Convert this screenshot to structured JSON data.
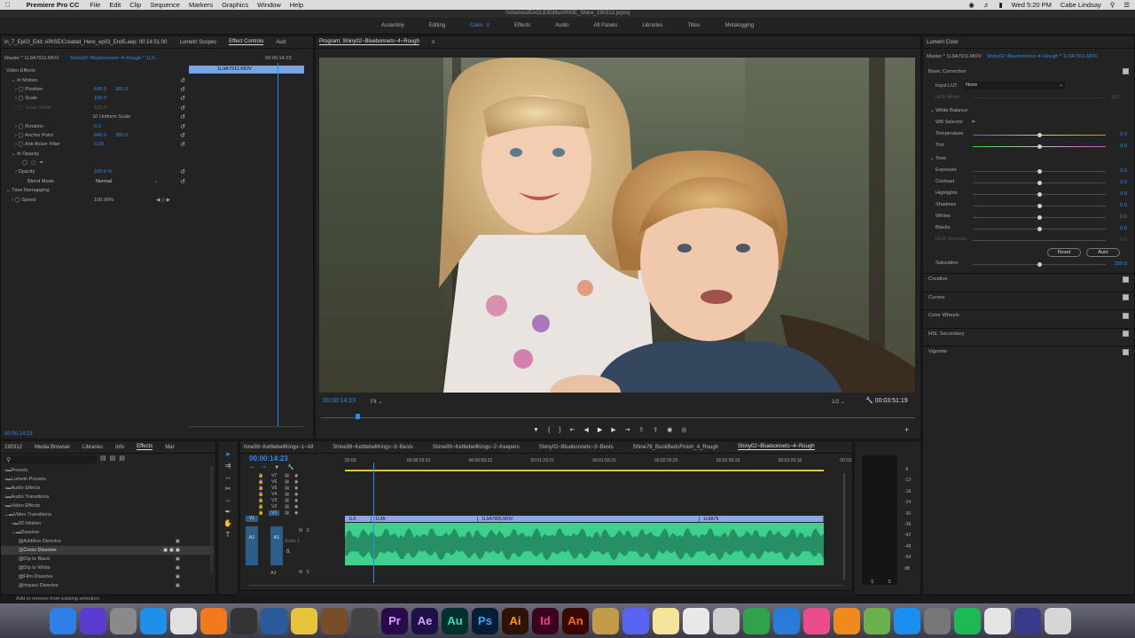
{
  "menubar": {
    "app": "Premiere Pro CC",
    "items": [
      "File",
      "Edit",
      "Clip",
      "Sequence",
      "Markers",
      "Graphics",
      "Window",
      "Help"
    ],
    "clock": "Wed 5:20 PM",
    "user": "Cabe Lindsay"
  },
  "window_title": "/Volumes/EAGLE/Edits/ARISE_Shine_190312.prproj",
  "workspaces": [
    {
      "label": "Assembly"
    },
    {
      "label": "Editing"
    },
    {
      "label": "Color",
      "active": true
    },
    {
      "label": "Effects"
    },
    {
      "label": "Audio"
    },
    {
      "label": "All Panels"
    },
    {
      "label": "Libraries"
    },
    {
      "label": "Titles"
    },
    {
      "label": "Metalogging"
    }
  ],
  "effect_controls": {
    "tabs": [
      "in_7_Ep03_Edit: ARISE/Created_Here_ep03_End5.aep: 00:14:51:00",
      "Lumetri Scopes",
      "Effect Controls",
      "Aud"
    ],
    "master": "Master * 1L9A7911.MOV",
    "sequence": "Shiny02~Bluebonnets~4~Rough * 1L9...",
    "mini_time": "00:00:14:23",
    "clip": "1L9A7911.MOV",
    "video_effects": "Video Effects",
    "motion": "Motion",
    "props": [
      {
        "name": "Position",
        "v1": "640.0",
        "v2": "360.0"
      },
      {
        "name": "Scale",
        "v1": "100.0"
      },
      {
        "name": "Scale Width",
        "v1": "100.0",
        "disabled": true
      },
      {
        "name": "Uniform Scale",
        "checkbox": true
      },
      {
        "name": "Rotation",
        "v1": "0.0"
      },
      {
        "name": "Anchor Point",
        "v1": "640.0",
        "v2": "360.0"
      },
      {
        "name": "Anti-flicker Filter",
        "v1": "0.00"
      }
    ],
    "opacity": "Opacity",
    "opacity_value": "100.0 %",
    "blend_mode_label": "Blend Mode",
    "blend_mode": "Normal",
    "time_remapping": "Time Remapping",
    "speed_label": "Speed",
    "speed_value": "100.00%",
    "timecode": "00:00:14:23"
  },
  "program": {
    "tab": "Program: Shiny02~Bluebonnets~4~Rough",
    "timecode": "00:00:14:23",
    "fit": "Fit",
    "resolution": "1/2",
    "duration": "00:03:51:19"
  },
  "lumetri": {
    "title": "Lumetri Color",
    "master": "Master * 1L9A7911.MOV",
    "sequence": "Shiny02~Bluebonnets~4~Rough * 1L9A7911.MOV",
    "basic_correction": "Basic Correction",
    "input_lut_label": "Input LUT",
    "input_lut": "None",
    "hdr_white": "HDR White",
    "hdr_white_val": "100",
    "white_balance": "White Balance",
    "wb_selector": "WB Selector",
    "wb": [
      {
        "name": "Temperature",
        "value": "0.0",
        "fill": 0.5
      },
      {
        "name": "Tint",
        "value": "0.0",
        "fill": 0.5
      }
    ],
    "tone": "Tone",
    "tone_sliders": [
      {
        "name": "Exposure",
        "value": "0.0",
        "fill": 0.5
      },
      {
        "name": "Contrast",
        "value": "0.0",
        "fill": 0.5
      },
      {
        "name": "Highlights",
        "value": "0.0",
        "fill": 0.5
      },
      {
        "name": "Shadows",
        "value": "0.0",
        "fill": 0.5
      },
      {
        "name": "Whites",
        "value": "0.0",
        "fill": 0.5
      },
      {
        "name": "Blacks",
        "value": "0.0",
        "fill": 0.5
      },
      {
        "name": "HDR Specular",
        "value": "0.0",
        "fill": 0.5,
        "disabled": true
      }
    ],
    "reset": "Reset",
    "auto": "Auto",
    "saturation": {
      "name": "Saturation",
      "value": "100.0",
      "fill": 0.5
    },
    "sections": [
      "Creative",
      "Curves",
      "Color Wheels",
      "HSL Secondary",
      "Vignette"
    ]
  },
  "effects_panel": {
    "tabs": [
      "190312",
      "Media Browser",
      "Libraries",
      "Info",
      "Effects",
      "Mar"
    ],
    "tree": [
      {
        "label": "Presets",
        "level": 0
      },
      {
        "label": "Lumetri Presets",
        "level": 0
      },
      {
        "label": "Audio Effects",
        "level": 0
      },
      {
        "label": "Audio Transitions",
        "level": 0
      },
      {
        "label": "Video Effects",
        "level": 0
      },
      {
        "label": "Video Transitions",
        "level": 0,
        "open": true
      },
      {
        "label": "3D Motion",
        "level": 1
      },
      {
        "label": "Dissolve",
        "level": 1,
        "open": true
      },
      {
        "label": "Additive Dissolve",
        "level": 2
      },
      {
        "label": "Cross Dissolve",
        "level": 2,
        "selected": true
      },
      {
        "label": "Dip to Black",
        "level": 2
      },
      {
        "label": "Dip to White",
        "level": 2
      },
      {
        "label": "Film Dissolve",
        "level": 2
      },
      {
        "label": "Impact Dissolve",
        "level": 2
      }
    ]
  },
  "timeline": {
    "tabs": [
      {
        "label": "hine99~KettlebellKings~1~All"
      },
      {
        "label": "Shine99~KettlebellKings~3~Bests"
      },
      {
        "label": "Shine99~KettlebellKings~2~Keepers"
      },
      {
        "label": "Shiny02~Bluebonnets~3~Bests"
      },
      {
        "label": "Shine78_BunkBedsFinish_4_Rough"
      },
      {
        "label": "Shiny02~Bluebonnets~4~Rough",
        "active": true
      }
    ],
    "timecode": "00:00:14:23",
    "ruler": [
      "00:00",
      "00:00:29:23",
      "00:00:59:22",
      "00:01:29:21",
      "00:01:59:21",
      "00:02:29:20",
      "00:02:59:19",
      "00:03:29:18",
      "00:03:"
    ],
    "video_tracks": [
      "V7",
      "V6",
      "V5",
      "V4",
      "V3",
      "V2",
      "V1"
    ],
    "audio_tracks": [
      "A1",
      "A2"
    ],
    "clips": [
      "1L9",
      "1L9A",
      "1L9A7955.MOV",
      "1L9A79"
    ],
    "audio_label": "Audio 1",
    "audio_value": "0.",
    "playhead": 0.06
  },
  "meter_scale": [
    "-6",
    "-12",
    "-18",
    "-24",
    "-30",
    "-36",
    "-42",
    "-48",
    "-54",
    "dB"
  ],
  "meter_bottom": [
    "S",
    "S"
  ],
  "status": "Add or remove from existing selection.",
  "dock": [
    {
      "name": "finder",
      "label": "",
      "color": "#2f7fe6"
    },
    {
      "name": "siri",
      "label": "",
      "color": "#5b3bd0"
    },
    {
      "name": "launchpad",
      "label": "",
      "color": "#8a8a8a"
    },
    {
      "name": "safari",
      "label": "",
      "color": "#1f8fe8"
    },
    {
      "name": "chrome",
      "label": "",
      "color": "#e0e0e0"
    },
    {
      "name": "firefox",
      "label": "",
      "color": "#f07a1c"
    },
    {
      "name": "photo-app",
      "label": "",
      "color": "#333"
    },
    {
      "name": "quicktime",
      "label": "",
      "color": "#2a5a9a"
    },
    {
      "name": "logic",
      "label": "",
      "color": "#e8c43c"
    },
    {
      "name": "garageband",
      "label": "",
      "color": "#7a4d2a"
    },
    {
      "name": "media-encoder",
      "label": "",
      "color": "#444"
    },
    {
      "name": "premiere",
      "label": "Pr",
      "color": "#2a0a4a"
    },
    {
      "name": "after-effects",
      "label": "Ae",
      "color": "#1f1147"
    },
    {
      "name": "audition",
      "label": "Au",
      "color": "#00312c"
    },
    {
      "name": "photoshop",
      "label": "Ps",
      "color": "#041f35"
    },
    {
      "name": "illustrator",
      "label": "Ai",
      "color": "#2e1400"
    },
    {
      "name": "indesign",
      "label": "Id",
      "color": "#3b0020"
    },
    {
      "name": "animate",
      "label": "An",
      "color": "#3a0800"
    },
    {
      "name": "utilities",
      "label": "",
      "color": "#c29a4a"
    },
    {
      "name": "discord",
      "label": "",
      "color": "#5865f2"
    },
    {
      "name": "notes",
      "label": "",
      "color": "#f4e39a"
    },
    {
      "name": "preview",
      "label": "",
      "color": "#e8e8e8"
    },
    {
      "name": "calculator",
      "label": "",
      "color": "#cfcfcf"
    },
    {
      "name": "numbers",
      "label": "",
      "color": "#2fa34a"
    },
    {
      "name": "keynote",
      "label": "",
      "color": "#2a7bd8"
    },
    {
      "name": "itunes",
      "label": "",
      "color": "#ea4d8a"
    },
    {
      "name": "books",
      "label": "",
      "color": "#f08a1c"
    },
    {
      "name": "maps",
      "label": "",
      "color": "#6ab04c"
    },
    {
      "name": "app-store",
      "label": "",
      "color": "#1b8ff0"
    },
    {
      "name": "system-prefs",
      "label": "",
      "color": "#777"
    },
    {
      "name": "spotify",
      "label": "",
      "color": "#1db954"
    },
    {
      "name": "acrobat",
      "label": "",
      "color": "#e5e5e5"
    },
    {
      "name": "bridge",
      "label": "",
      "color": "#3a3a8a"
    },
    {
      "name": "trash",
      "label": "",
      "color": "#d6d6d6"
    }
  ],
  "colors": {
    "accent": "#2d8ceb",
    "audio": "#3dd08e",
    "video_clip": "#8da7e6",
    "panel": "#232323"
  }
}
